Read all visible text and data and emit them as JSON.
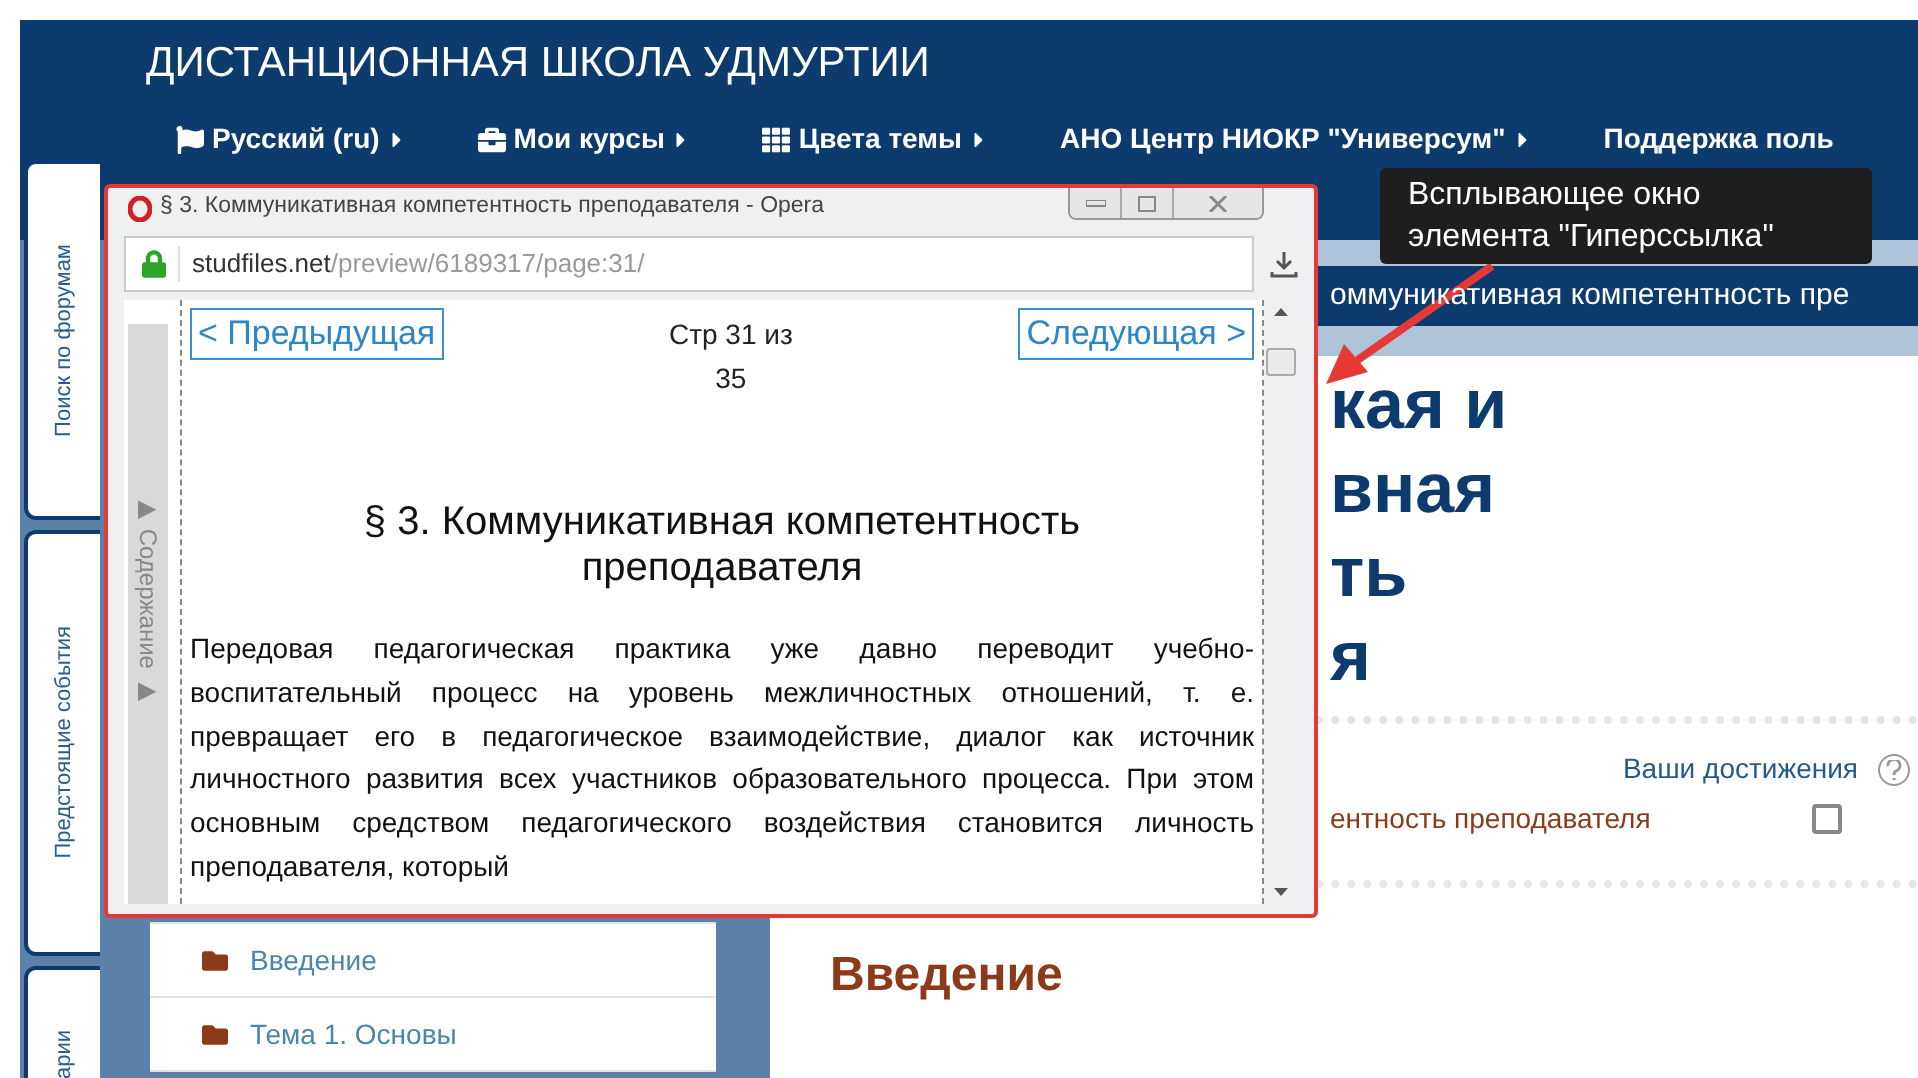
{
  "site": {
    "title": "ДИСТАНЦИОННАЯ ШКОЛА УДМУРТИИ",
    "nav": [
      {
        "label": "Русский (ru)",
        "submenu": true
      },
      {
        "label": "Мои курсы",
        "submenu": true
      },
      {
        "label": "Цвета темы",
        "submenu": true
      },
      {
        "label": "АНО Центр НИОКР \"Универсум\"",
        "submenu": true
      },
      {
        "label": "Поддержка поль",
        "submenu": false
      }
    ]
  },
  "side_tabs": [
    "Поиск по форумам",
    "Предстоящие события",
    "арии"
  ],
  "banner_bar": "оммуникативная компетентность пре",
  "course_title_lines": [
    "кая и",
    "вная",
    "ть",
    "я"
  ],
  "achievements": "Ваши достижения",
  "activity": {
    "label": "ентность преподавателя",
    "checked": false
  },
  "sidebar_items": [
    "Введение",
    "Тема 1. Основы"
  ],
  "section_heading": "Введение",
  "popup": {
    "title": "§ 3. Коммуникативная компетентность преподавателя - Opera",
    "url_host": "studfiles.net",
    "url_path": "/preview/6189317/page:31/",
    "toc_label": "▶ Содержание ▶",
    "prev": "< Предыдущая",
    "next": "Следующая >",
    "page_info": "Стр 31 из 35",
    "heading": "§ 3. Коммуникативная компетентность преподавателя",
    "paragraph": "Передовая педагогическая практика уже давно переводит учебно-воспитательный процесс на уровень межличностных отношений, т. е. превращает его в педагогическое взаимодействие, диалог как источник личностного развития всех участников образовательного процесса. При этом основным средством педагогического воздействия становится личность преподавателя, который"
  },
  "callout": "Всплывающее окно элемента \"Гиперссылка\""
}
